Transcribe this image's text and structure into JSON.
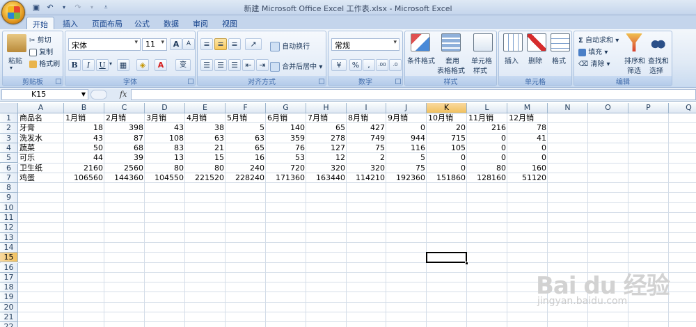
{
  "window": {
    "title": "新建 Microsoft Office Excel 工作表.xlsx - Microsoft Excel"
  },
  "quick_access": {
    "save_icon": "save-icon",
    "undo_icon": "undo-icon",
    "redo_icon": "redo-icon",
    "customize_icon": "qat-dropdown-icon"
  },
  "tabs": [
    "开始",
    "插入",
    "页面布局",
    "公式",
    "数据",
    "审阅",
    "视图"
  ],
  "active_tab": "开始",
  "ribbon": {
    "clipboard": {
      "label": "剪贴板",
      "paste": "粘贴",
      "cut": "剪切",
      "copy": "复制",
      "format_painter": "格式刷"
    },
    "font": {
      "label": "字体",
      "font_name": "宋体",
      "font_size": "11",
      "bold": "B",
      "italic": "I",
      "underline": "U",
      "grow": "A",
      "shrink": "A",
      "wen": "变"
    },
    "alignment": {
      "label": "对齐方式",
      "wrap": "自动换行",
      "merge": "合并后居中"
    },
    "number": {
      "label": "数字",
      "format": "常规",
      "percent": "%",
      "comma": ",",
      "inc": ".00",
      "dec": ".0"
    },
    "styles": {
      "label": "样式",
      "conditional": "条件格式",
      "table": "套用\n表格格式",
      "table1": "套用",
      "table2": "表格格式",
      "cell_style1": "单元格",
      "cell_style2": "样式"
    },
    "cells": {
      "label": "单元格",
      "insert": "插入",
      "delete": "删除",
      "format": "格式"
    },
    "editing": {
      "label": "编辑",
      "autosum": "自动求和",
      "fill": "填充",
      "clear": "清除",
      "sort1": "排序和",
      "sort2": "筛选",
      "find1": "查找和",
      "find2": "选择"
    }
  },
  "formula_bar": {
    "name_box": "K15",
    "fx": "fx",
    "formula": ""
  },
  "columns": [
    "A",
    "B",
    "C",
    "D",
    "E",
    "F",
    "G",
    "H",
    "I",
    "J",
    "K",
    "L",
    "M",
    "N",
    "O",
    "P",
    "Q"
  ],
  "rows": [
    "1",
    "2",
    "3",
    "4",
    "5",
    "6",
    "7",
    "8",
    "9",
    "10",
    "11",
    "12",
    "13",
    "14",
    "15",
    "16",
    "17",
    "18",
    "19",
    "20",
    "21",
    "22"
  ],
  "selected_cell": {
    "col": "K",
    "row": "15"
  },
  "sheet": {
    "headers": [
      "商品名",
      "1月销",
      "2月销",
      "3月销",
      "4月销",
      "5月销",
      "6月销",
      "7月销",
      "8月销",
      "9月销",
      "10月销",
      "11月销",
      "12月销"
    ],
    "data": [
      [
        "牙膏",
        "18",
        "398",
        "43",
        "38",
        "5",
        "140",
        "65",
        "427",
        "0",
        "20",
        "216",
        "78"
      ],
      [
        "洗发水",
        "43",
        "87",
        "108",
        "63",
        "63",
        "359",
        "278",
        "749",
        "944",
        "715",
        "0",
        "41"
      ],
      [
        "蔬菜",
        "50",
        "68",
        "83",
        "21",
        "65",
        "76",
        "127",
        "75",
        "116",
        "105",
        "0",
        "0"
      ],
      [
        "可乐",
        "44",
        "39",
        "13",
        "15",
        "16",
        "53",
        "12",
        "2",
        "5",
        "0",
        "0",
        "0"
      ],
      [
        "卫生纸",
        "2160",
        "2560",
        "80",
        "80",
        "240",
        "720",
        "320",
        "320",
        "75",
        "0",
        "80",
        "160"
      ],
      [
        "鸡蛋",
        "106560",
        "144360",
        "104550",
        "221520",
        "228240",
        "171360",
        "163440",
        "114210",
        "192360",
        "151860",
        "128160",
        "51120"
      ]
    ]
  },
  "watermark": {
    "main": "Bai du 经验",
    "sub": "jingyan.baidu.com"
  }
}
